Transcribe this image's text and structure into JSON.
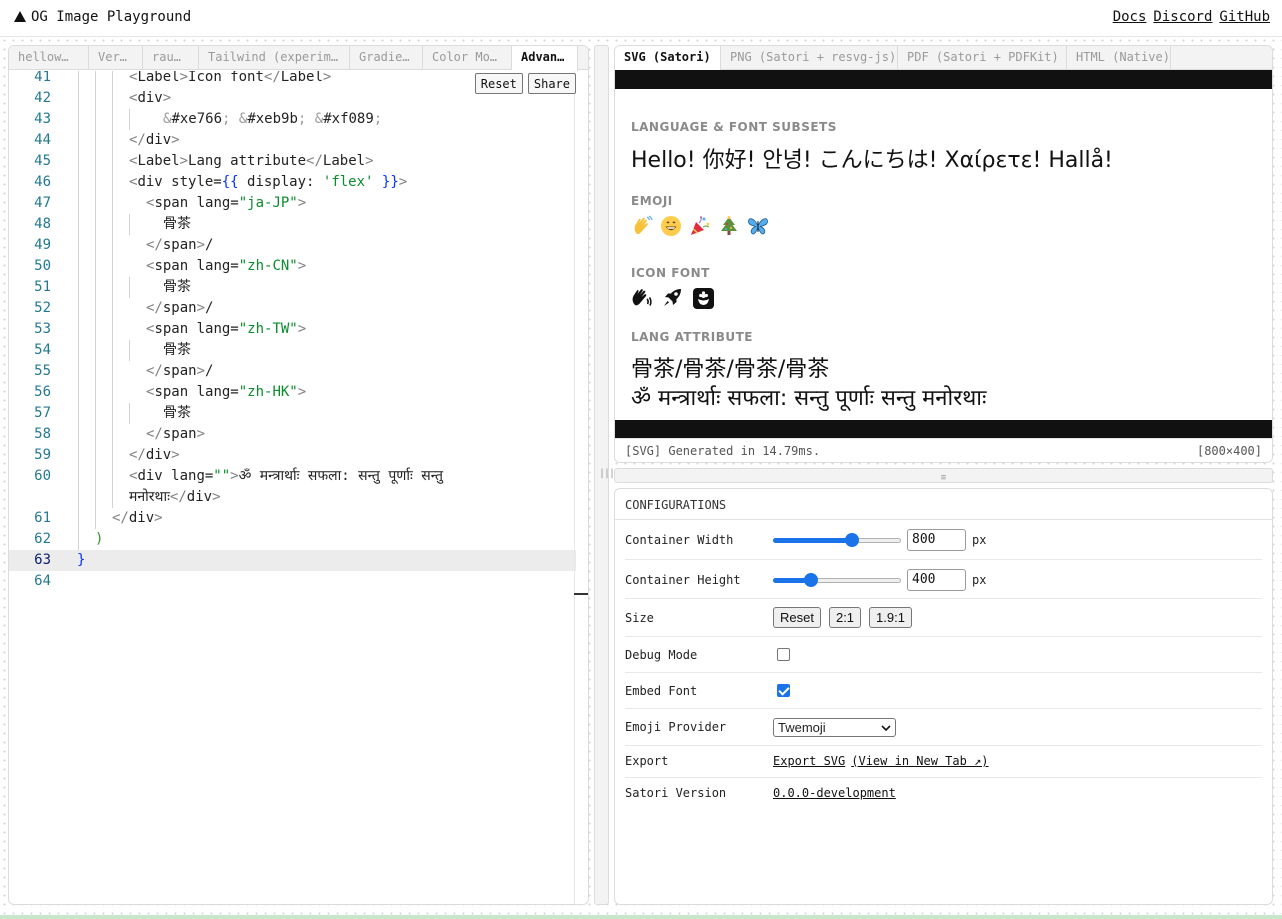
{
  "header": {
    "title": "OG Image Playground",
    "nav": [
      "Docs",
      "Discord",
      "GitHub"
    ]
  },
  "editor": {
    "tabs": [
      "hellow…",
      "Ver…",
      "rau…",
      "Tailwind (experim…",
      "Gradie…",
      "Color Mo…",
      "Advan…"
    ],
    "active_tab": "Advan…",
    "reset_label": "Reset",
    "share_label": "Share",
    "cursor_line": "63",
    "lines": [
      {
        "num": "41",
        "text": "<Label>Icon font</Label>"
      },
      {
        "num": "42",
        "text": "<div>"
      },
      {
        "num": "43",
        "text": "&#xe766; &#xeb9b; &#xf089;"
      },
      {
        "num": "44",
        "text": "</div>"
      },
      {
        "num": "45",
        "text": "<Label>Lang attribute</Label>"
      },
      {
        "num": "46",
        "text": "<div style={{ display: 'flex' }}>"
      },
      {
        "num": "47",
        "text": "<span lang=\"ja-JP\">"
      },
      {
        "num": "48",
        "text": "骨茶"
      },
      {
        "num": "49",
        "text": "</span>/"
      },
      {
        "num": "50",
        "text": "<span lang=\"zh-CN\">"
      },
      {
        "num": "51",
        "text": "骨茶"
      },
      {
        "num": "52",
        "text": "</span>/"
      },
      {
        "num": "53",
        "text": "<span lang=\"zh-TW\">"
      },
      {
        "num": "54",
        "text": "骨茶"
      },
      {
        "num": "55",
        "text": "</span>/"
      },
      {
        "num": "56",
        "text": "<span lang=\"zh-HK\">"
      },
      {
        "num": "57",
        "text": "骨茶"
      },
      {
        "num": "58",
        "text": "</span>"
      },
      {
        "num": "59",
        "text": "</div>"
      },
      {
        "num": "60",
        "text": "<div lang=\"\">ॐ मन्त्रार्थाः सफला: सन्तु पूर्णाः सन्तु मनोरथाः</div>"
      },
      {
        "num": "61",
        "text": "</div>"
      },
      {
        "num": "62",
        "text": ")"
      },
      {
        "num": "63",
        "text": "}"
      },
      {
        "num": "64",
        "text": ""
      }
    ]
  },
  "preview": {
    "tabs": [
      "SVG (Satori)",
      "PNG (Satori + resvg-js)",
      "PDF (Satori + PDFKit)",
      "HTML (Native)"
    ],
    "active_tab": "SVG (Satori)",
    "sections": {
      "lang_label": "LANGUAGE & FONT SUBSETS",
      "lang_text": "Hello! 你好! 안녕! こんにちは! Χαίρετε! Hallå!",
      "emoji_label": "EMOJI",
      "icon_label": "ICON FONT",
      "attr_label": "LANG ATTRIBUTE",
      "attr_line1": "骨茶/骨茶/骨茶/骨茶",
      "attr_line2": "ॐ मन्त्रार्थाः सफला: सन्तु पूर्णाः सन्तु मनोरथाः"
    },
    "emoji": [
      "waving-hand",
      "grinning-face",
      "party-popper",
      "christmas-tree",
      "butterfly"
    ],
    "icons": [
      "wave-icon",
      "rocket-icon",
      "flower-box-icon"
    ],
    "status_left": "[SVG] Generated in 14.79ms.",
    "status_right": "[800×400]"
  },
  "config": {
    "heading": "CONFIGURATIONS",
    "width": {
      "label": "Container Width",
      "value": "800",
      "unit": "px",
      "fraction": 0.62
    },
    "height": {
      "label": "Container Height",
      "value": "400",
      "unit": "px",
      "fraction": 0.3
    },
    "size": {
      "label": "Size",
      "buttons": [
        "Reset",
        "2:1",
        "1.9:1"
      ]
    },
    "debug": {
      "label": "Debug Mode",
      "checked": false
    },
    "embed": {
      "label": "Embed Font",
      "checked": true
    },
    "emoji_provider": {
      "label": "Emoji Provider",
      "value": "Twemoji"
    },
    "export": {
      "label": "Export",
      "link1": "Export SVG",
      "link2": "(View in New Tab ↗)"
    },
    "version": {
      "label": "Satori Version",
      "value": "0.0.0-development"
    }
  },
  "colors": {
    "accent": "#1a73e8",
    "line_number": "#237893",
    "string": "#0a8c2b"
  }
}
